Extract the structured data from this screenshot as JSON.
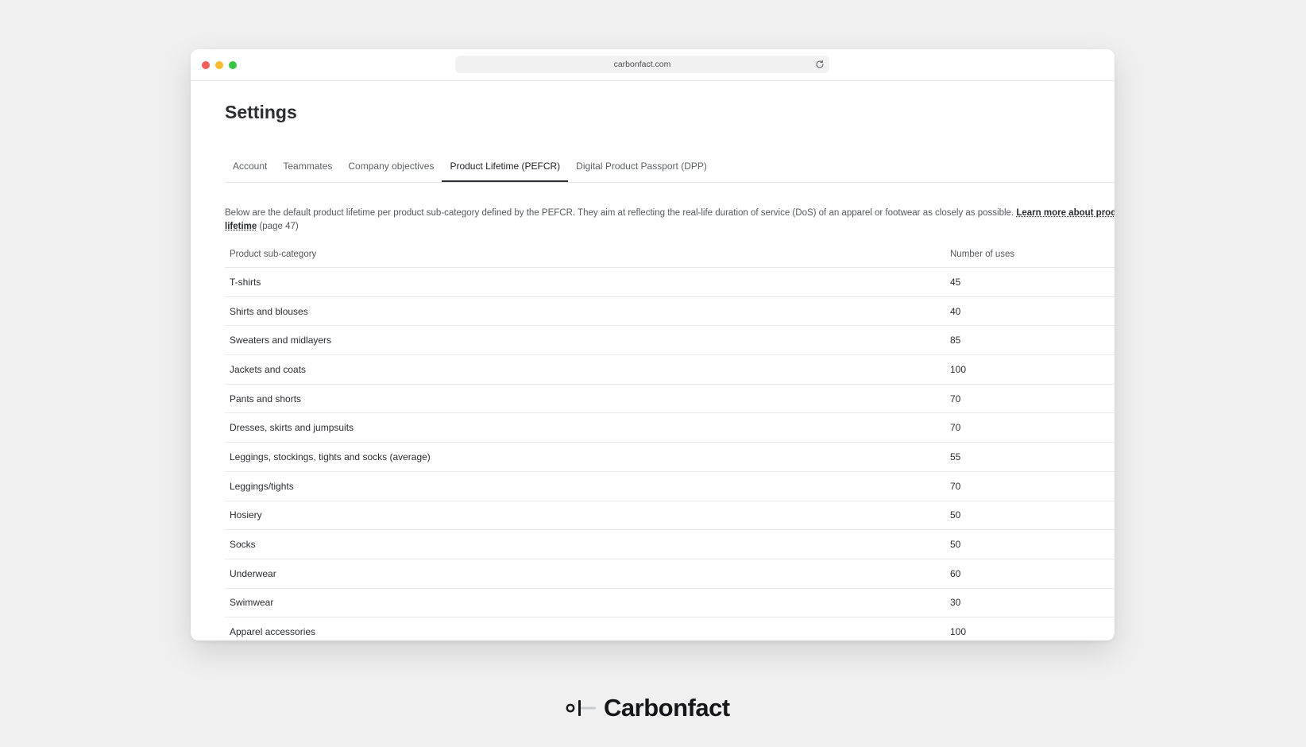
{
  "browser": {
    "url": "carbonfact.com"
  },
  "page": {
    "title": "Settings"
  },
  "tabs": [
    {
      "label": "Account"
    },
    {
      "label": "Teammates"
    },
    {
      "label": "Company objectives"
    },
    {
      "label": "Product Lifetime (PEFCR)",
      "active": true
    },
    {
      "label": "Digital Product Passport (DPP)"
    }
  ],
  "description": {
    "text": "Below are the default product lifetime per product sub-category defined by the PEFCR. They aim at reflecting the real-life duration of service (DoS) of an apparel or footwear as closely as possible.",
    "link": "Learn more about product lifetime",
    "suffix": "(page 47)"
  },
  "table": {
    "headers": {
      "category": "Product sub-category",
      "uses": "Number of uses"
    },
    "rows": [
      {
        "category": "T-shirts",
        "uses": "45"
      },
      {
        "category": "Shirts and blouses",
        "uses": "40"
      },
      {
        "category": "Sweaters and midlayers",
        "uses": "85"
      },
      {
        "category": "Jackets and coats",
        "uses": "100"
      },
      {
        "category": "Pants and shorts",
        "uses": "70"
      },
      {
        "category": "Dresses, skirts and jumpsuits",
        "uses": "70"
      },
      {
        "category": "Leggings, stockings, tights and socks (average)",
        "uses": "55"
      },
      {
        "category": "Leggings/tights",
        "uses": "70"
      },
      {
        "category": "Hosiery",
        "uses": "50"
      },
      {
        "category": "Socks",
        "uses": "50"
      },
      {
        "category": "Underwear",
        "uses": "60"
      },
      {
        "category": "Swimwear",
        "uses": "30"
      },
      {
        "category": "Apparel accessories",
        "uses": "100"
      }
    ]
  },
  "brand": {
    "name": "Carbonfact",
    "logo_icon": "carbonfact-logo-icon"
  },
  "icons": {
    "reload": "reload-icon"
  },
  "colors": {
    "background": "#eff0ef",
    "text": "#2b2d31",
    "close_dot": "#f25f58",
    "minimize_dot": "#f8bc2f",
    "maximize_dot": "#3ac445"
  }
}
